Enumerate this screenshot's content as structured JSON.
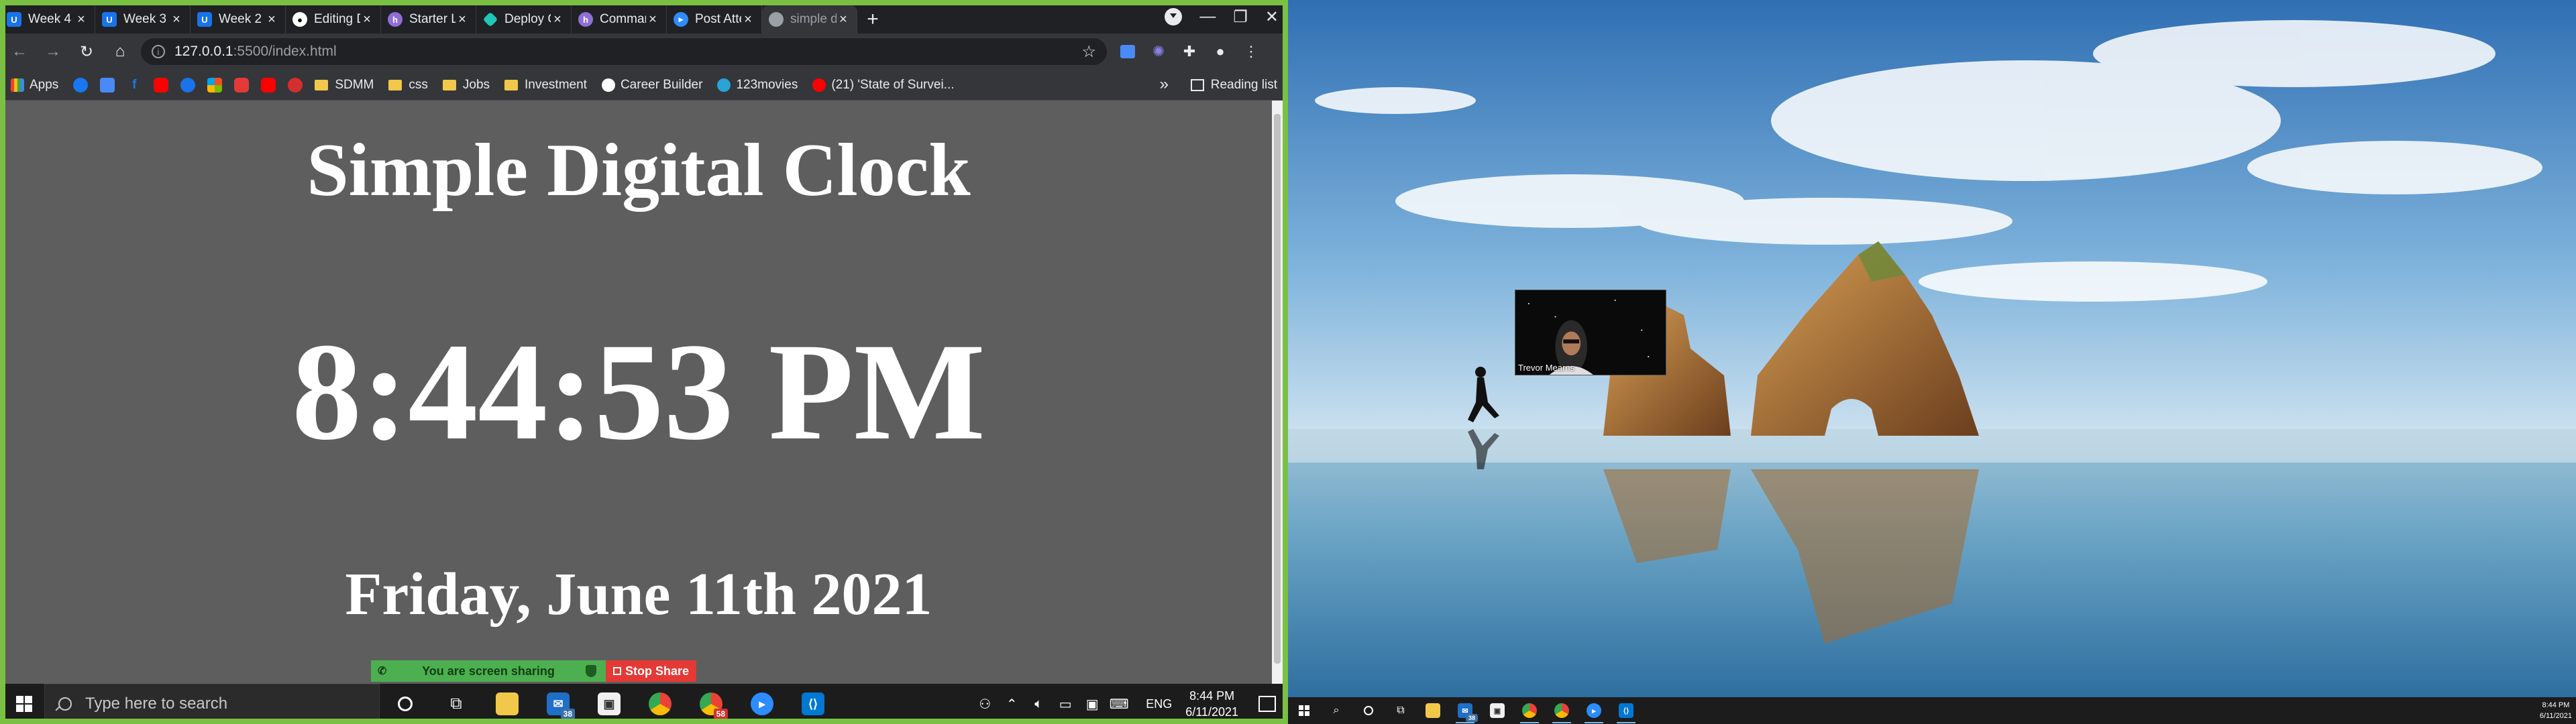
{
  "browser": {
    "tabs": [
      {
        "label": "Week 4 :",
        "favicon": "U",
        "favicon_color": "#1a73e8",
        "active": false
      },
      {
        "label": "Week 3 :",
        "favicon": "U",
        "favicon_color": "#1a73e8",
        "active": false
      },
      {
        "label": "Week 2 :",
        "favicon": "U",
        "favicon_color": "#1a73e8",
        "active": false
      },
      {
        "label": "Editing D",
        "favicon": "github",
        "favicon_color": "#ffffff",
        "active": false
      },
      {
        "label": "Starter L",
        "favicon": "heroku",
        "favicon_color": "#8f6ed5",
        "active": false
      },
      {
        "label": "Deploy C",
        "favicon": "netlify",
        "favicon_color": "#20c6b7",
        "active": false
      },
      {
        "label": "Comman",
        "favicon": "heroku",
        "favicon_color": "#8f6ed5",
        "active": false
      },
      {
        "label": "Post Atte",
        "favicon": "zoom",
        "favicon_color": "#2d8cff",
        "active": false
      },
      {
        "label": "simple di",
        "favicon": "globe",
        "favicon_color": "#9aa0a6",
        "active": true
      }
    ],
    "address": {
      "host": "127.0.0.1",
      "path": ":5500/index.html"
    },
    "bookmarks": {
      "apps_label": "Apps",
      "items": [
        {
          "label": "SDMM",
          "type": "folder"
        },
        {
          "label": "css",
          "type": "folder"
        },
        {
          "label": "Jobs",
          "type": "folder"
        },
        {
          "label": "Investment",
          "type": "folder"
        },
        {
          "label": "Career Builder",
          "type": "site"
        },
        {
          "label": "123movies",
          "type": "site"
        },
        {
          "label": "(21) 'State of Survei...",
          "type": "site"
        }
      ],
      "more": "»",
      "reading_list": "Reading list"
    }
  },
  "page": {
    "title": "Simple Digital Clock",
    "time": "8:44:53 PM",
    "date": "Friday, June 11th 2021",
    "background": "#5e5e5e"
  },
  "share_bar": {
    "status": "You are screen sharing",
    "stop": "Stop Share",
    "border_color": "#7ac143"
  },
  "taskbar_left": {
    "search_placeholder": "Type here to search",
    "mail_badge": "38",
    "chrome_badge": "58",
    "lang": "ENG",
    "time": "8:44 PM",
    "date": "6/11/2021"
  },
  "taskbar_right": {
    "mail_badge": "38",
    "time": "8:44 PM",
    "date": "6/11/2021"
  },
  "zoom_video": {
    "participant": "Trevor Mearns"
  }
}
